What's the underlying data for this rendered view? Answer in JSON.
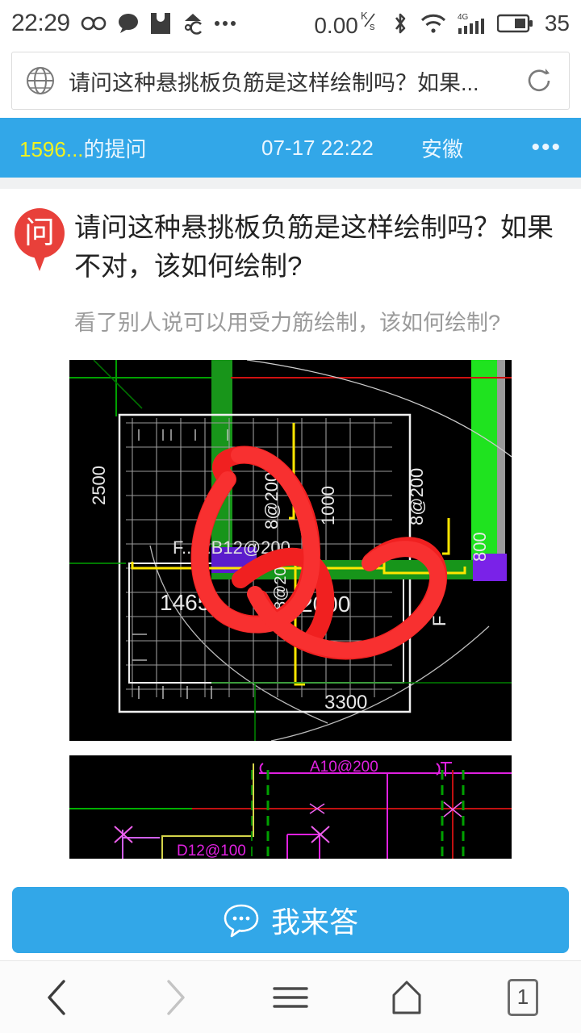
{
  "statusbar": {
    "time": "22:29",
    "icons_left": [
      "infinity-icon",
      "chat-bubble-icon",
      "mail-icon",
      "temperature-icon",
      "more-dots-icon"
    ],
    "net_speed": "0.00",
    "net_speed_unit_top": "K",
    "net_speed_unit_bottom": "s",
    "icons_right": [
      "bluetooth-icon",
      "wifi-icon",
      "signal-4g-icon",
      "battery-icon"
    ],
    "battery_percent": "35"
  },
  "urlbar": {
    "globe_icon": "globe-icon",
    "title": "请问这种悬挑板负筋是这样绘制吗？如果...",
    "refresh_icon": "refresh-icon"
  },
  "metabar": {
    "asker_id": "1596...",
    "asker_suffix": "的提问",
    "date": "07-17 22:22",
    "region": "安徽",
    "more": "•••",
    "accent_color": "#32A7E8",
    "highlight_color": "#F2F21E"
  },
  "question": {
    "badge_char": "问",
    "badge_color": "#E8403A",
    "title": "请问这种悬挑板负筋是这样绘制吗？如果不对，该如何绘制?",
    "subtitle": "看了别人说可以用受力筋绘制，该如何绘制?"
  },
  "images": [
    {
      "name": "cad-screenshot-1",
      "background": "#000000",
      "labels": [
        "2500",
        "8@200",
        "1000",
        "8@200",
        "800",
        "F...8:B12@200",
        "1465",
        "2000",
        "3300"
      ],
      "annotation": "red-circle-markup"
    },
    {
      "name": "cad-screenshot-2",
      "background": "#000000",
      "labels": [
        "A10@200",
        "D12@100"
      ],
      "annotation": "none"
    }
  ],
  "answer_button": {
    "icon": "speech-bubble-icon",
    "label": "我来答",
    "color": "#32A7E8"
  },
  "navbar": {
    "items": [
      {
        "name": "back-button",
        "icon": "chevron-left-icon",
        "enabled": true
      },
      {
        "name": "forward-button",
        "icon": "chevron-right-icon",
        "enabled": false
      },
      {
        "name": "menu-button",
        "icon": "hamburger-icon",
        "enabled": true
      },
      {
        "name": "home-button",
        "icon": "home-icon",
        "enabled": true
      },
      {
        "name": "tabs-button",
        "icon": "tab-count-icon",
        "enabled": true
      }
    ],
    "tab_count": "1"
  }
}
